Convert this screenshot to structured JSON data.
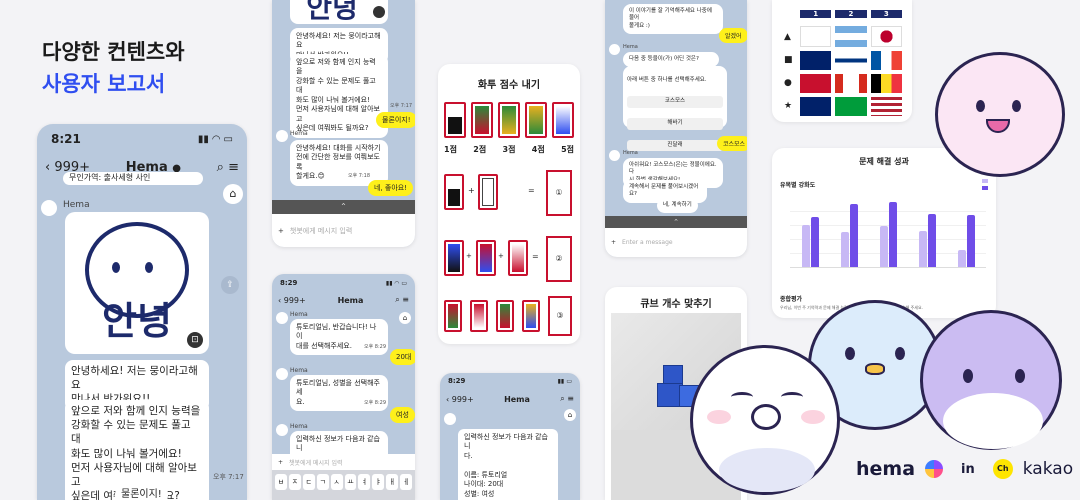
{
  "promo": {
    "headline1": "다양한 컨텐츠와",
    "headline2": "사용자 보고서"
  },
  "colors": {
    "accent_blue": "#2f4ef0",
    "kakao_yellow": "#fee500",
    "chat_bg": "#b9c9dd",
    "bar_light": "#c7b8f5",
    "bar_dark": "#6f4de8",
    "card_red": "#c8102e"
  },
  "main_phone": {
    "time": "8:21",
    "back_label": "999+",
    "title": "Hema",
    "prev_msg": "무인가역: 출사세형 사인",
    "sender": "Hema",
    "image_text": "안녕",
    "msg1": "안녕하세요! 저는 뭉이라고해요\n만나서 반가워요!!",
    "msg2": "앞으로 저와 함께 인지 능력을\n강화할 수 있는 문제도 풀고 대\n화도 많이 나눠 볼거에요!\n먼저 사용자님에 대해 알아보고\n싶은데 여쭤봐도 될까요?",
    "msg2_time": "오후 7:17",
    "reply": "물론이지!"
  },
  "phone2": {
    "image_text": "안녕",
    "msg1": "안녕하세요! 저는 뭉이라고해요\n만나서 반가워요!!",
    "msg2": "앞으로 저와 함께 인지 능력을\n강화할 수 있는 문제도 풀고 대\n화도 많이 나눠 볼거에요!\n먼저 사용자님에 대해 알아보고\n싶은데 여쭤봐도 될까요?",
    "msg2_time": "오후 7:17",
    "reply1": "물론이지!",
    "sender": "Hema",
    "msg3": "안녕하세요! 대화를 시작하기\n전에 간단한 정보를 여쭤보도록\n할게요.😊",
    "msg3_time": "오후 7:18",
    "reply2": "네, 좋아요!",
    "input_placeholder": "챗봇에게 메시지 입력"
  },
  "phone3": {
    "time": "8:29",
    "back_label": "999+",
    "title": "Hema",
    "sender": "Hema",
    "msg1": "튜토리얼님, 반갑습니다! 나이\n대를 선택해주세요.",
    "msg1_time": "오후 8:29",
    "reply1": "20대",
    "msg2": "튜토리얼님, 성별을 선택해주세\n요.",
    "msg2_time": "오후 8:29",
    "reply2": "여성",
    "msg3": "입력하신 정보가 다음과 같습니\n다.",
    "input_placeholder": "챗봇에게 메시지 입력",
    "kb_row": [
      "ㅂ",
      "ㅈ",
      "ㄷ",
      "ㄱ",
      "ㅅ",
      "ㅛ",
      "ㅕ",
      "ㅑ",
      "ㅐ",
      "ㅔ"
    ]
  },
  "phone4": {
    "time": "8:29",
    "back_label": "999+",
    "title": "Hema",
    "msg": "입력하신 정보가 다음과 같습니\n다.\n\n이름: 튜토리얼\n나이대: 20대\n성별: 여성"
  },
  "phone5": {
    "msg_top": "이 이야기를 잘 기억해주세요 나중에 물어\n볼게요 :)",
    "reply_top": "알겠어",
    "sender": "Hema",
    "msg_q": "다음 중 등을이(가) 어딘 것은?",
    "options_title": "아래 버튼 중 하나를 선택해주세요.",
    "options": [
      "코스모스",
      "해바기",
      "진달래"
    ],
    "reply_answer": "코스모스",
    "msg_result": "아쉬워요! 코스모스(은)는 정물이에요. 다\n시 한번 생각해보세요!",
    "msg_continue": "계속해서 문제를 풀어보시겠어요?",
    "reply_continue": "네, 계속하기",
    "input_placeholder": "Enter a message"
  },
  "hwatu": {
    "title": "화투 점수 내기",
    "scores": [
      "1점",
      "2점",
      "3점",
      "4점",
      "5점"
    ],
    "eq_answers": [
      "①",
      "②",
      "③"
    ]
  },
  "cube": {
    "title": "큐브 개수 맞추기"
  },
  "flags": {
    "col_labels": [
      "1",
      "2",
      "3"
    ]
  },
  "report": {
    "title": "문제 해결 성과",
    "chart_title": "유목별 강화도",
    "section": "종합평가",
    "summary": "우리님, 이번 주 기억력과 문제 해결 능력이 향상되었어요. 계속 꾸준히 학습해 주세요."
  },
  "chart_data": {
    "type": "bar",
    "title": "유목별 강화도",
    "series": [
      {
        "name": "",
        "values": [
          60,
          50,
          58,
          52,
          25
        ]
      },
      {
        "name": "",
        "values": [
          72,
          90,
          93,
          76,
          75
        ]
      }
    ],
    "ylim": [
      0,
      100
    ]
  },
  "branding": {
    "hema": "hema",
    "in": "in",
    "kakao": "kakao",
    "kakao_badge": "Ch"
  }
}
